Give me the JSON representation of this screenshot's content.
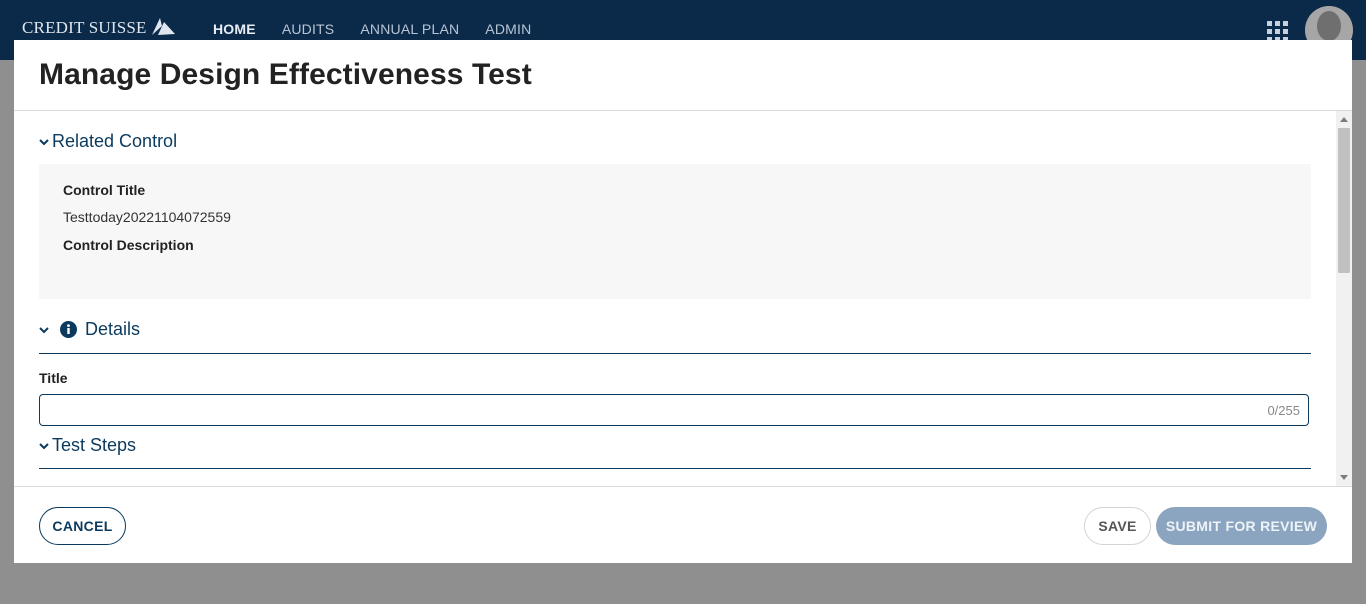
{
  "nav": {
    "brand": "CREDIT SUISSE",
    "links": [
      "HOME",
      "AUDITS",
      "ANNUAL PLAN",
      "ADMIN"
    ],
    "active": "HOME"
  },
  "modal": {
    "title": "Manage Design Effectiveness Test",
    "related_control": {
      "heading": "Related Control",
      "control_title_label": "Control Title",
      "control_title_value": "Testtoday20221104072559",
      "control_description_label": "Control Description"
    },
    "details": {
      "heading": "Details",
      "title_label": "Title",
      "title_value": "",
      "title_counter": "0/255"
    },
    "test_steps": {
      "heading": "Test Steps"
    },
    "footer": {
      "cancel": "CANCEL",
      "save": "SAVE",
      "submit": "SUBMIT FOR REVIEW"
    }
  },
  "colors": {
    "nav_bg": "#0b2a4a",
    "accent": "#0b3a5e",
    "submit_disabled": "#8ba4bf",
    "overlay": "#8f8f8f"
  },
  "icons": [
    "sail-logo-icon",
    "apps-grid-icon",
    "user-avatar-icon",
    "chevron-down-icon",
    "info-icon",
    "scroll-up-arrow-icon",
    "scroll-down-arrow-icon"
  ]
}
